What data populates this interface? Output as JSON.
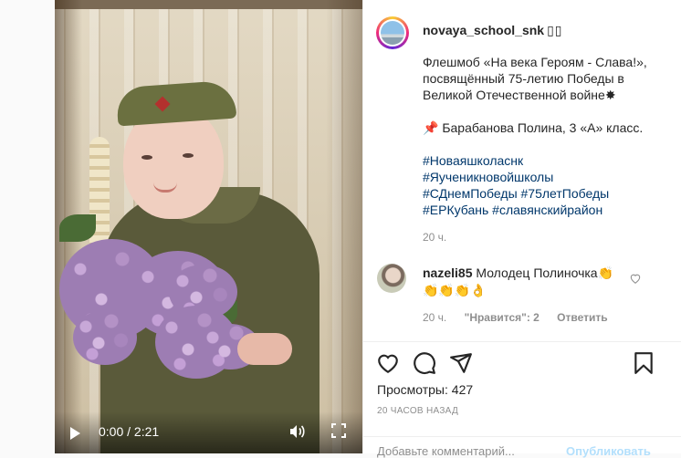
{
  "post": {
    "username": "novaya_school_snk",
    "username_icons": "▯▯",
    "caption_lines": [
      "Флешмоб «На века Героям - Слава!»,",
      "посвящённый 75-летию Победы в",
      "Великой Отечественной войне✸"
    ],
    "caption_author": "📌 Барабанова Полина, 3 «А» класс.",
    "hashtag_line1": "#Новаяшколаснк",
    "hashtag_line2": "#Яученикновойшколы",
    "hashtag_line3": "#СДнемПобеды #75летПобеды",
    "hashtag_line4": "#ЕРКубань #славянскийрайон",
    "time_ago": "20 ч."
  },
  "comment": {
    "username": "nazeli85",
    "text_line1": "Молодец Полиночка👏",
    "text_line2": "👏👏👏👌",
    "time": "20 ч.",
    "likes": "\"Нравится\": 2",
    "reply_label": "Ответить"
  },
  "video": {
    "time_display": "0:00 / 2:21",
    "play_icon": "play-icon",
    "volume_icon": "volume-icon",
    "fullscreen_icon": "fullscreen-icon"
  },
  "actions": {
    "icons": [
      "heart-icon",
      "comment-icon",
      "share-icon",
      "bookmark-icon"
    ],
    "views_label": "Просмотры:",
    "views_count": "427",
    "age_label": "20 ЧАСОВ НАЗАД"
  },
  "composer": {
    "placeholder": "Добавьте комментарий...",
    "publish_label": "Опубликовать"
  }
}
